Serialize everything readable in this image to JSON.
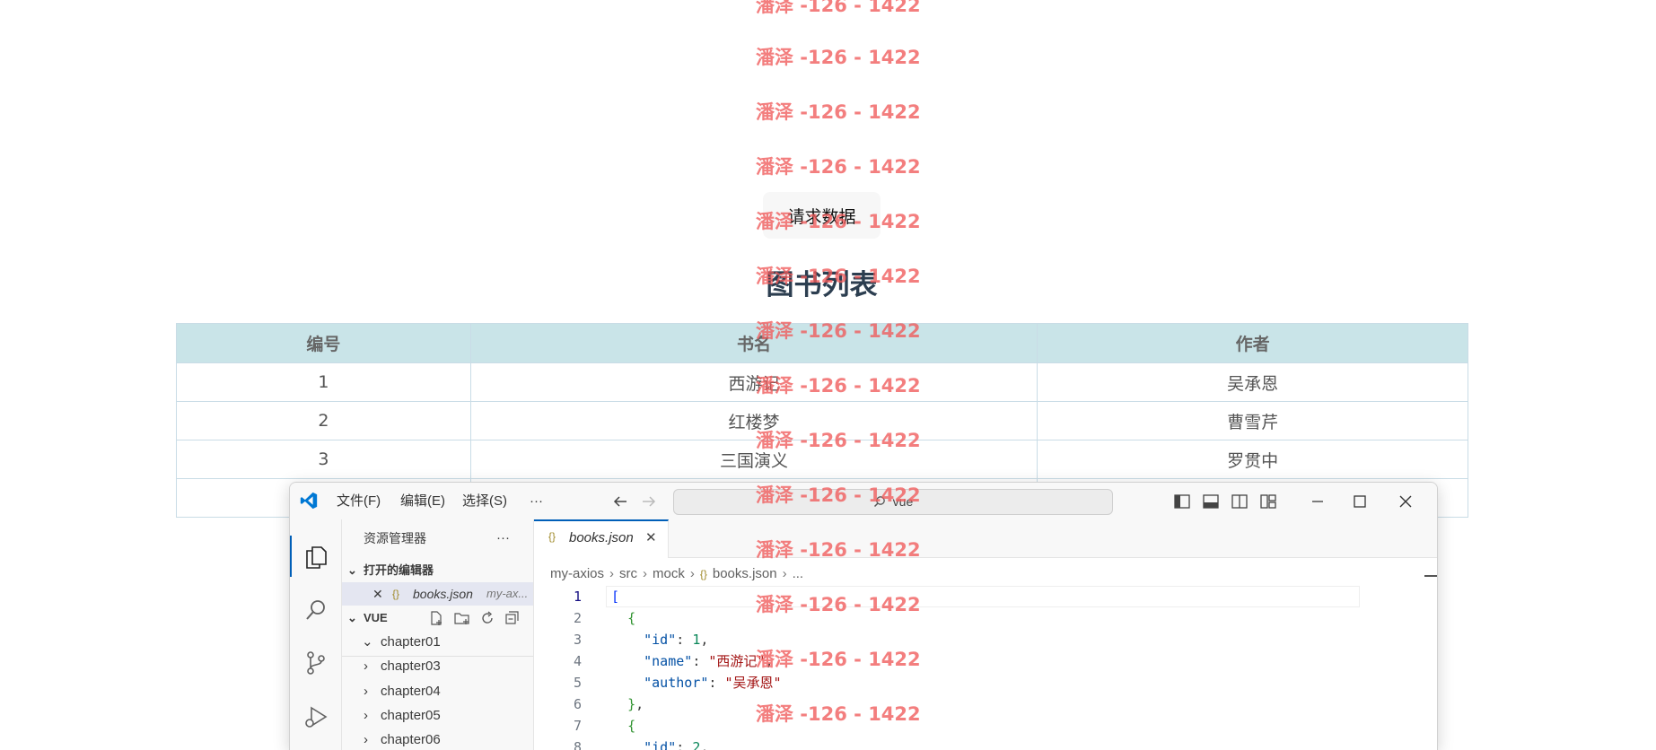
{
  "page": {
    "request_button": "请求数据",
    "title": "图书列表",
    "table": {
      "headers": [
        "编号",
        "书名",
        "作者"
      ],
      "rows": [
        [
          "1",
          "西游记",
          "吴承恩"
        ],
        [
          "2",
          "红楼梦",
          "曹雪芹"
        ],
        [
          "3",
          "三国演义",
          "罗贯中"
        ]
      ]
    }
  },
  "watermark": "潘泽 -126 - 1422",
  "vscode": {
    "menu": [
      "文件(F)",
      "编辑(E)",
      "选择(S)",
      "···"
    ],
    "search_text": "vue",
    "sidebar": {
      "title": "资源管理器",
      "more": "···",
      "open_editors_label": "打开的编辑器",
      "open_file_name": "books.json",
      "open_file_path": "my-ax...",
      "workspace_label": "VUE",
      "folders": [
        "chapter01",
        "chapter03",
        "chapter04",
        "chapter05",
        "chapter06"
      ]
    },
    "tab": {
      "name": "books.json",
      "icon": "{}"
    },
    "breadcrumb": [
      "my-axios",
      "src",
      "mock",
      "books.json",
      "..."
    ],
    "code": {
      "line_numbers": [
        "1",
        "2",
        "3",
        "4",
        "5",
        "6",
        "7",
        "8"
      ],
      "lines": [
        {
          "indent": "",
          "parts": [
            {
              "c": "b1",
              "t": "["
            }
          ]
        },
        {
          "indent": "  ",
          "parts": [
            {
              "c": "b2",
              "t": "{"
            }
          ]
        },
        {
          "indent": "    ",
          "parts": [
            {
              "c": "k",
              "t": "\"id\""
            },
            {
              "c": "",
              "t": ": "
            },
            {
              "c": "n",
              "t": "1"
            },
            {
              "c": "",
              "t": ","
            }
          ]
        },
        {
          "indent": "    ",
          "parts": [
            {
              "c": "k",
              "t": "\"name\""
            },
            {
              "c": "",
              "t": ": "
            },
            {
              "c": "s",
              "t": "\"西游记\""
            },
            {
              "c": "",
              "t": ","
            }
          ]
        },
        {
          "indent": "    ",
          "parts": [
            {
              "c": "k",
              "t": "\"author\""
            },
            {
              "c": "",
              "t": ": "
            },
            {
              "c": "s",
              "t": "\"吴承恩\""
            }
          ]
        },
        {
          "indent": "  ",
          "parts": [
            {
              "c": "b2",
              "t": "}"
            },
            {
              "c": "",
              "t": ","
            }
          ]
        },
        {
          "indent": "  ",
          "parts": [
            {
              "c": "b2",
              "t": "{"
            }
          ]
        },
        {
          "indent": "    ",
          "parts": [
            {
              "c": "k",
              "t": "\"id\""
            },
            {
              "c": "",
              "t": ": "
            },
            {
              "c": "n",
              "t": "2"
            },
            {
              "c": "",
              "t": ","
            }
          ]
        }
      ]
    },
    "colors": {
      "accent": "#005fb8",
      "vscode_blue": "#0078d4",
      "watermark": "#f05a5a",
      "table_header_bg": "#c9e4e8"
    }
  }
}
